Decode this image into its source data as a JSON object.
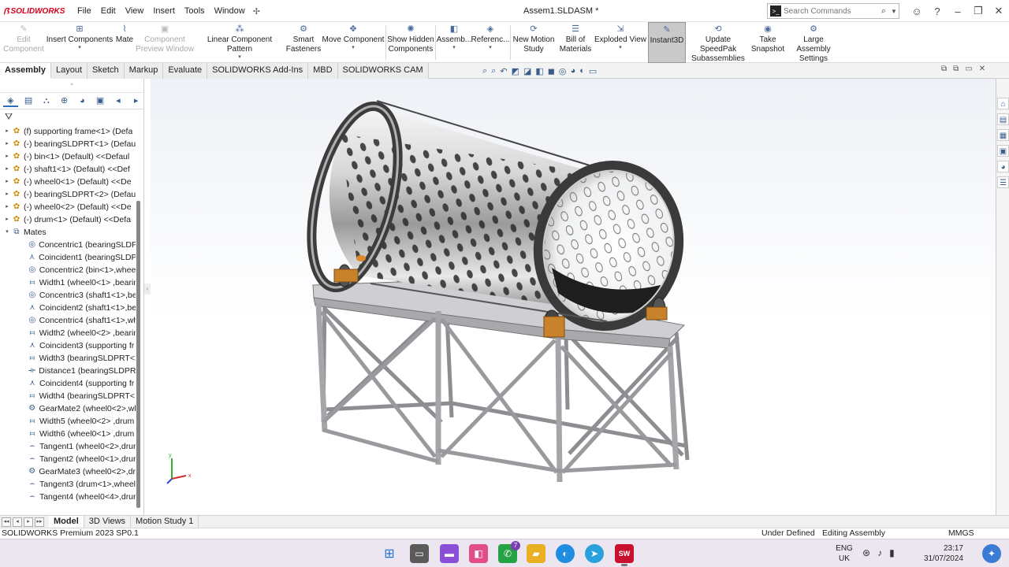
{
  "app": {
    "logo": "SOLIDWORKS",
    "doc_title": "Assem1.SLDASM *"
  },
  "menu": [
    "File",
    "Edit",
    "View",
    "Insert",
    "Tools",
    "Window"
  ],
  "search": {
    "placeholder": "Search Commands"
  },
  "commands": {
    "edit_component": "Edit Component",
    "insert_components": "Insert Components",
    "mate": "Mate",
    "component_preview": "Component Preview Window",
    "linear_pattern": "Linear Component Pattern",
    "smart_fasteners": "Smart Fasteners",
    "move_component": "Move Component",
    "show_hidden": "Show Hidden Components",
    "assembly": "Assemb...",
    "reference": "Referenc...",
    "new_motion": "New Motion Study",
    "bom": "Bill of Materials",
    "exploded": "Exploded View",
    "instant3d": "Instant3D",
    "update_speedpak": "Update SpeedPak Subassemblies",
    "snapshot": "Take Snapshot",
    "large_assembly": "Large Assembly Settings"
  },
  "tabs": [
    "Assembly",
    "Layout",
    "Sketch",
    "Markup",
    "Evaluate",
    "SOLIDWORKS Add-Ins",
    "MBD",
    "SOLIDWORKS CAM"
  ],
  "tree": {
    "components": [
      "(f) supporting frame<1> (Defa",
      "(-) bearingSLDPRT<1> (Defau",
      "(-) bin<1> (Default) <<Defaul",
      "(-) shaft1<1> (Default) <<Def",
      "(-) wheel0<1> (Default) <<De",
      "(-) bearingSLDPRT<2> (Defau",
      "(-) wheel0<2> (Default) <<De",
      "(-) drum<1> (Default) <<Defa"
    ],
    "mates_label": "Mates",
    "mates": [
      {
        "icon": "concentric-icon",
        "label": "Concentric1 (bearingSLDPF"
      },
      {
        "icon": "coincident-icon",
        "label": "Coincident1 (bearingSLDPF"
      },
      {
        "icon": "concentric-icon",
        "label": "Concentric2 (bin<1>,wheel"
      },
      {
        "icon": "width-icon",
        "label": "Width1 (wheel0<1> ,bearin"
      },
      {
        "icon": "concentric-icon",
        "label": "Concentric3 (shaft1<1>,be"
      },
      {
        "icon": "coincident-icon",
        "label": "Coincident2 (shaft1<1>,be"
      },
      {
        "icon": "concentric-icon",
        "label": "Concentric4 (shaft1<1>,wh"
      },
      {
        "icon": "width-icon",
        "label": "Width2 (wheel0<2> ,bearin"
      },
      {
        "icon": "coincident-icon",
        "label": "Coincident3 (supporting fr"
      },
      {
        "icon": "width-icon",
        "label": "Width3 (bearingSLDPRT<2"
      },
      {
        "icon": "distance-icon",
        "label": "Distance1 (bearingSLDPRT"
      },
      {
        "icon": "coincident-icon",
        "label": "Coincident4 (supporting fr"
      },
      {
        "icon": "width-icon",
        "label": "Width4 (bearingSLDPRT<1"
      },
      {
        "icon": "gear-mate-icon",
        "label": "GearMate2 (wheel0<2>,wh"
      },
      {
        "icon": "width-icon",
        "label": "Width5 (wheel0<2> ,drum"
      },
      {
        "icon": "width-icon",
        "label": "Width6 (wheel0<1> ,drum"
      },
      {
        "icon": "tangent-icon",
        "label": "Tangent1 (wheel0<2>,drur"
      },
      {
        "icon": "tangent-icon",
        "label": "Tangent2 (wheel0<1>,drur"
      },
      {
        "icon": "gear-mate-icon",
        "label": "GearMate3 (wheel0<2>,dru"
      },
      {
        "icon": "tangent-icon",
        "label": "Tangent3 (drum<1>,wheel"
      },
      {
        "icon": "tangent-icon",
        "label": "Tangent4 (wheel0<4>,drur"
      }
    ]
  },
  "bottom_tabs": [
    "Model",
    "3D Views",
    "Motion Study 1"
  ],
  "status": {
    "product": "SOLIDWORKS Premium 2023 SP0.1",
    "defined": "Under Defined",
    "editing": "Editing Assembly",
    "units": "MMGS"
  },
  "triad": {
    "x": "x",
    "y": "y"
  },
  "tray": {
    "lang1": "ENG",
    "lang2": "UK",
    "time": "23:17",
    "date": "31/07/2024",
    "whatsapp_badge": "7"
  },
  "colors": {
    "accent": "#d6001c",
    "frame": "#b8b8bc",
    "bracket": "#c8822c",
    "taskbar": "#ece6f1"
  }
}
